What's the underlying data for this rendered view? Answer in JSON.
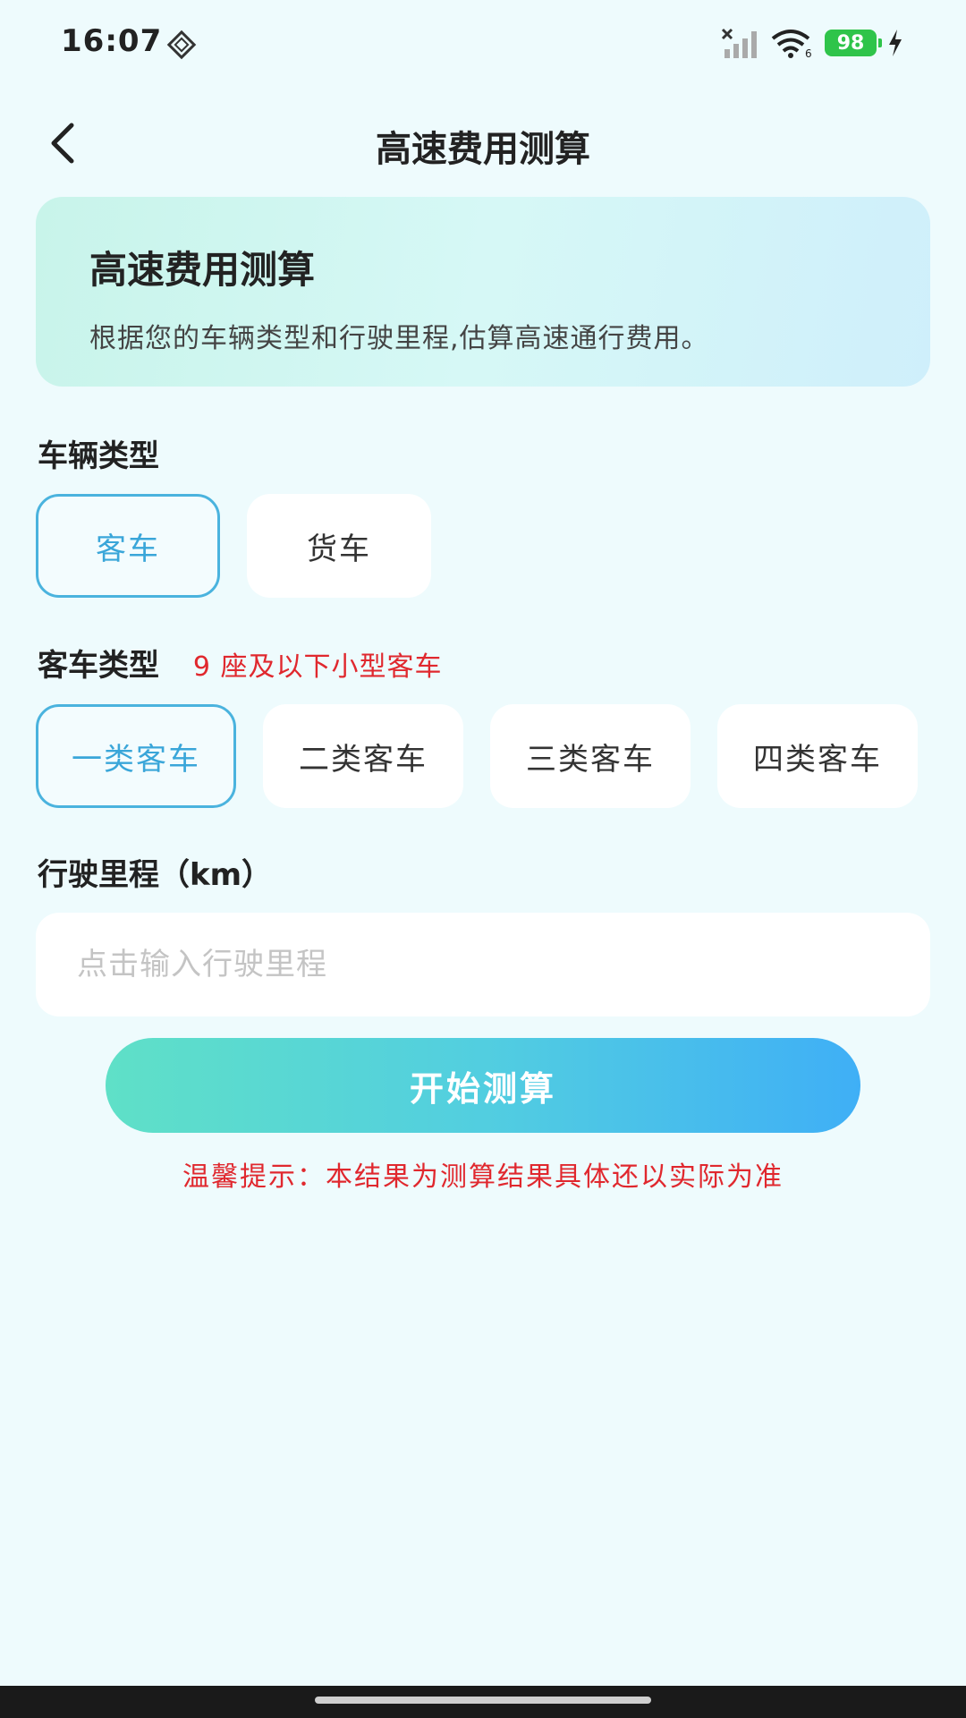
{
  "status_bar": {
    "time": "16:07",
    "battery": "98"
  },
  "header": {
    "title": "高速费用测算"
  },
  "intro": {
    "title": "高速费用测算",
    "description": "根据您的车辆类型和行驶里程,估算高速通行费用。"
  },
  "vehicle_type": {
    "label": "车辆类型",
    "options": [
      "客车",
      "货车"
    ],
    "selected": "客车"
  },
  "bus_type": {
    "label": "客车类型",
    "note": "9 座及以下小型客车",
    "options": [
      "一类客车",
      "二类客车",
      "三类客车",
      "四类客车"
    ],
    "selected": "一类客车"
  },
  "mileage": {
    "label": "行驶里程（km）",
    "placeholder": "点击输入行驶里程",
    "value": ""
  },
  "calculate": {
    "label": "开始测算"
  },
  "tip": "温馨提示：本结果为测算结果具体还以实际为准",
  "colors": {
    "accent": "#4ab3de",
    "warning": "#e0282e",
    "battery": "#2fc44a",
    "background": "#eefbfd"
  }
}
